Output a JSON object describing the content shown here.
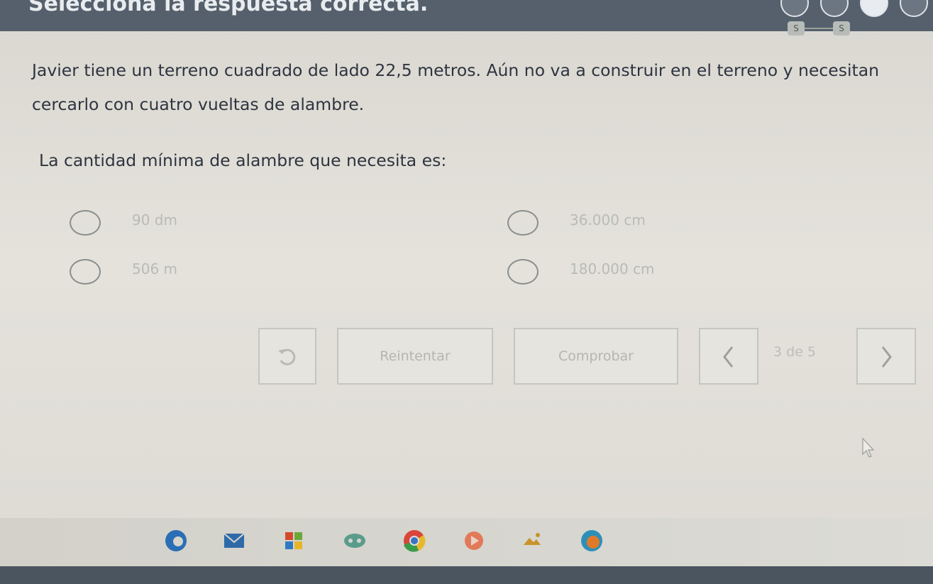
{
  "header": {
    "title": "Selecciona la respuesta correcta.",
    "question_tags": [
      "S",
      "S"
    ]
  },
  "question": {
    "text": "Javier tiene un terreno cuadrado de lado 22,5 metros. Aún no va a construir en el terreno y necesitan cercarlo con cuatro vueltas de alambre.",
    "prompt": "La cantidad mínima de alambre que necesita es:"
  },
  "options": [
    {
      "label": "90 dm"
    },
    {
      "label": "36.000 cm"
    },
    {
      "label": "506 m"
    },
    {
      "label": "180.000 cm"
    }
  ],
  "controls": {
    "reset_icon": "undo-arrow-icon",
    "retry_label": "Reintentar",
    "check_label": "Comprobar",
    "prev_icon": "chevron-left-icon",
    "next_icon": "chevron-right-icon",
    "page_counter": "3 de 5"
  },
  "taskbar": {
    "icons": [
      "edge-icon",
      "mail-icon",
      "store-icon",
      "game-icon",
      "chrome-icon",
      "media-icon",
      "photos-icon",
      "app-icon"
    ]
  }
}
